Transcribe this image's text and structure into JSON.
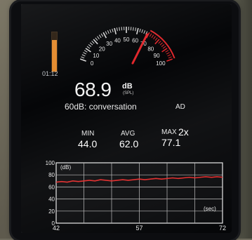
{
  "meter": {
    "current_value": "68.9",
    "unit": "dB",
    "unit_sub": "(SPL)",
    "reference_text": "60dB: conversation",
    "elapsed_time": "01:12",
    "level_fraction": 0.8,
    "needle_value": 69
  },
  "gauge": {
    "ticks": [
      "0",
      "10",
      "20",
      "30",
      "40",
      "50",
      "60",
      "70",
      "80",
      "90",
      "100"
    ]
  },
  "controls": {
    "ad_label": "AD",
    "speed_label": "2x"
  },
  "stats": {
    "min_label": "MIN",
    "min_value": "44.0",
    "avg_label": "AVG",
    "avg_value": "62.0",
    "max_label": "MAX",
    "max_value": "77.1"
  },
  "graph": {
    "y_unit_label": "(dB)",
    "x_unit_label": "(sec)",
    "y_ticks": [
      "100",
      "80",
      "60",
      "40",
      "20",
      "0"
    ],
    "x_ticks": [
      "42",
      "57",
      "72"
    ]
  },
  "chart_data": {
    "type": "line",
    "title": "",
    "xlabel": "(sec)",
    "ylabel": "(dB)",
    "xlim": [
      42,
      72
    ],
    "ylim": [
      0,
      100
    ],
    "series": [
      {
        "x": [
          42,
          43,
          44,
          45,
          46,
          47,
          48,
          49,
          50,
          51,
          52,
          53,
          54,
          55,
          56,
          57,
          58,
          59,
          60,
          61,
          62,
          63,
          64,
          65,
          66,
          67,
          68,
          69,
          70,
          71,
          72
        ],
        "values": [
          68,
          69,
          68,
          70,
          69,
          70,
          71,
          70,
          72,
          71,
          70,
          71,
          72,
          71,
          72,
          73,
          72,
          73,
          74,
          73,
          74,
          75,
          74,
          75,
          76,
          75,
          76,
          77,
          76,
          77,
          76
        ]
      }
    ]
  },
  "colors": {
    "line": "#e22a2a",
    "gauge_red": "#e0262b",
    "level_orange": "#e48a2c"
  }
}
